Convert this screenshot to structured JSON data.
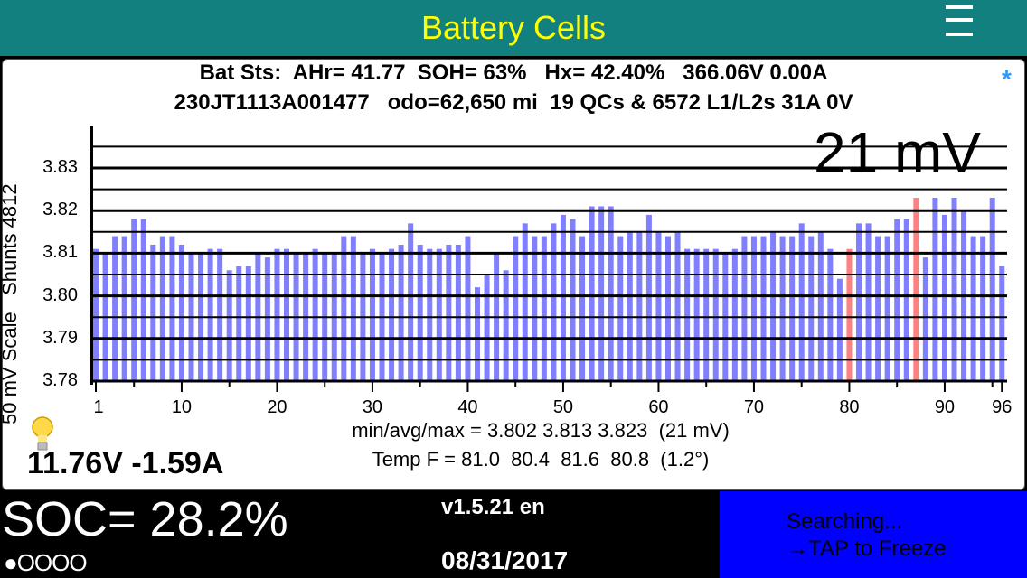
{
  "header": {
    "title": "Battery Cells",
    "menu_icon": "hamburger-menu-icon"
  },
  "info": {
    "line1": "Bat Sts:  AHr= 41.77  SOH= 63%   Hx= 42.40%   366.06V 0.00A",
    "line2": "230JT1113A001477   odo=62,650 mi  19 QCs & 6572 L1/L2s 31A 0V",
    "star": "*"
  },
  "chart_data": {
    "type": "bar",
    "ylabel": "50 mV Scale   Shunts 4812",
    "spread_label": "21 mV",
    "ylim": [
      3.78,
      3.835
    ],
    "yticks": [
      "3.78",
      "3.79",
      "3.80",
      "3.81",
      "3.82",
      "3.83"
    ],
    "xticks": [
      "1",
      "10",
      "20",
      "30",
      "40",
      "50",
      "60",
      "70",
      "80",
      "90",
      "96"
    ],
    "bar_color": "#8080ff",
    "highlight_color": "#ff8080",
    "highlighted_cells": [
      80,
      87
    ],
    "grid": true,
    "categories_range": [
      1,
      96
    ],
    "values": [
      3.811,
      3.81,
      3.814,
      3.814,
      3.818,
      3.818,
      3.812,
      3.814,
      3.814,
      3.812,
      3.81,
      3.81,
      3.811,
      3.811,
      3.806,
      3.807,
      3.807,
      3.81,
      3.809,
      3.811,
      3.811,
      3.81,
      3.81,
      3.811,
      3.81,
      3.81,
      3.814,
      3.814,
      3.81,
      3.811,
      3.81,
      3.811,
      3.812,
      3.817,
      3.812,
      3.811,
      3.811,
      3.812,
      3.812,
      3.814,
      3.802,
      3.805,
      3.81,
      3.806,
      3.814,
      3.817,
      3.814,
      3.814,
      3.817,
      3.819,
      3.818,
      3.814,
      3.821,
      3.821,
      3.821,
      3.814,
      3.815,
      3.815,
      3.819,
      3.815,
      3.814,
      3.815,
      3.811,
      3.811,
      3.811,
      3.811,
      3.81,
      3.811,
      3.814,
      3.814,
      3.814,
      3.815,
      3.814,
      3.814,
      3.817,
      3.814,
      3.815,
      3.811,
      3.804,
      3.811,
      3.817,
      3.817,
      3.814,
      3.814,
      3.818,
      3.818,
      3.823,
      3.809,
      3.823,
      3.819,
      3.823,
      3.82,
      3.814,
      3.814,
      3.823,
      3.807
    ]
  },
  "stats": {
    "minavgmax": "min/avg/max = 3.802 3.813 3.823  (21 mV)",
    "temp": "Temp F = 81.0  80.4  81.6  80.8  (1.2°)"
  },
  "aux_battery": {
    "text": "11.76V -1.59A",
    "icon": "lightbulb-icon"
  },
  "footer": {
    "soc": "SOC= 28.2%",
    "page_dots": "●OOOO",
    "version": "v1.5.21 en",
    "date": "08/31/2017",
    "status_line1": "Searching...",
    "status_line2": "→TAP to Freeze",
    "status_color": "#0000ff"
  }
}
